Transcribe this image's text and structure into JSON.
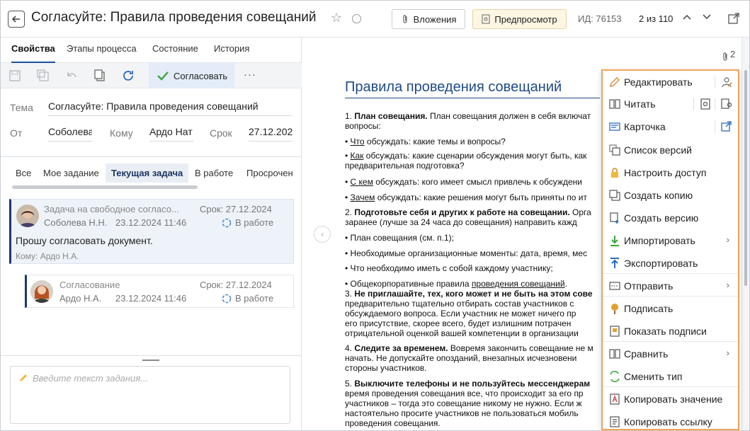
{
  "header": {
    "title": "Согласуйте: Правила проведения совещаний",
    "attachments": "Вложения",
    "preview": "Предпросмотр",
    "id": "ИД: 76153",
    "counter": "2 из 110"
  },
  "tabs": [
    "Свойства",
    "Этапы процесса",
    "Состояние",
    "История"
  ],
  "toolbar": {
    "approve": "Согласовать",
    "more": "···"
  },
  "fields": {
    "subject_label": "Тема",
    "subject": "Согласуйте: Правила проведения совещаний",
    "from_label": "От",
    "from": "Соболева",
    "to_label": "Кому",
    "to": "Ардо Нат",
    "due_label": "Срок",
    "due": "27.12.202"
  },
  "task_tabs": [
    "Все",
    "Мое задание",
    "Текущая задача",
    "В работе",
    "Просрочен"
  ],
  "tasks": [
    {
      "title": "Задача на свободное согласо...",
      "due": "Срок: 27.12.2024",
      "author": "Соболева Н.Н.",
      "date": "23.12.2024 11:46",
      "status": "В работе",
      "text": "Прошу согласовать документ.",
      "to": "Кому: Ардо Н.А."
    },
    {
      "title": "Согласование",
      "due": "Срок: 27.12.2024",
      "author": "Ардо Н.А.",
      "date": "23.12.2024 11:46",
      "status": "В работе"
    }
  ],
  "task_input": {
    "placeholder": "Введите текст задания..."
  },
  "doc": {
    "attach_count": "2",
    "title": "Правила проведения совещаний",
    "lines": [
      {
        "t": "1.  ",
        "b": "План совещания.",
        "r": " План совещания должен в себя включат"
      },
      {
        "t": "      вопросы:"
      },
      {
        "t": "•   ",
        "u": "Что",
        "r": " обсуждать: какие темы и вопросы?"
      },
      {
        "t": "•   ",
        "u": "Как",
        "r": " обсуждать: какие сценарии обсуждения могут быть, как"
      },
      {
        "t": "      предварительная подготовка?"
      },
      {
        "t": "•   ",
        "u": "С кем",
        "r": " обсуждать: кого имеет смысл привлечь к обсуждени"
      },
      {
        "t": "•   ",
        "u": "Зачем",
        "r": " обсуждать: какие решения могут быть приняты по ит"
      },
      {
        "t": "2.  ",
        "b": "Подготовьте себя и других к работе на совещании.",
        "r": " Орга"
      },
      {
        "t": "      заранее (лучше за 24 часа до совещания) направить кажд"
      },
      {
        "t": "•   План совещания (см. п.1);"
      },
      {
        "t": "•   Необходимые организационные моменты: дата, время, мес"
      },
      {
        "t": "•   Что необходимо иметь с собой каждому участнику;"
      },
      {
        "t": "•   Общекорпоративные правила ",
        "u": "проведения совещаний",
        "r": "."
      },
      {
        "t": "3.  ",
        "b": "Не приглашайте, тех, кого может и не быть на этом сове"
      },
      {
        "t": "      предварительно тщательно отбирать состав участников с"
      },
      {
        "t": "      обсуждаемого вопроса. Если участник не может ничего пр"
      },
      {
        "t": "      его присутствие, скорее всего, будет излишним потрачен"
      },
      {
        "t": "      отрицательной оценкой вашей компетенции в организации"
      },
      {
        "t": "4.  ",
        "b": "Следите за временем.",
        "r": " Вовремя закончить совещание не м"
      },
      {
        "t": "      начать. Не допускайте опозданий, внезапных исчезновени"
      },
      {
        "t": "      стороны участников."
      },
      {
        "t": "5.  ",
        "b": "Выключите телефоны и не пользуйтесь мессенджерам"
      },
      {
        "t": "      время проведения совещания все, что происходит за его пр"
      },
      {
        "t": "      участников – тогда это совещание никому не нужно. Если ж"
      },
      {
        "t": "      настоятельно просите участников не пользоваться мобиль"
      },
      {
        "t": "      проведения совещания."
      }
    ]
  },
  "menu": [
    {
      "label": "Редактировать",
      "icon": "pencil-icon",
      "extra": [
        "edit-people-icon"
      ]
    },
    {
      "label": "Читать",
      "icon": "book-icon",
      "extra": [
        "preview-doc-icon",
        "read-people-icon"
      ]
    },
    {
      "label": "Карточка",
      "icon": "card-icon",
      "extra": [
        "open-external-icon"
      ]
    },
    {
      "label": "Список версий",
      "icon": "versions-icon"
    },
    {
      "label": "Настроить доступ",
      "icon": "lock-icon"
    },
    {
      "label": "Создать копию",
      "icon": "copy-icon"
    },
    {
      "label": "Создать версию",
      "icon": "new-version-icon"
    },
    {
      "label": "Импортировать",
      "icon": "import-icon",
      "submenu": true
    },
    {
      "label": "Экспортировать",
      "icon": "export-icon"
    },
    {
      "label": "Отправить",
      "icon": "send-icon",
      "submenu": true
    },
    {
      "label": "Подписать",
      "icon": "sign-icon"
    },
    {
      "label": "Показать подписи",
      "icon": "signatures-icon"
    },
    {
      "label": "Сравнить",
      "icon": "compare-icon",
      "submenu": true
    },
    {
      "label": "Сменить тип",
      "icon": "change-type-icon"
    },
    {
      "label": "Копировать значение",
      "icon": "copy-value-icon"
    },
    {
      "label": "Копировать ссылку",
      "icon": "copy-link-icon"
    }
  ]
}
